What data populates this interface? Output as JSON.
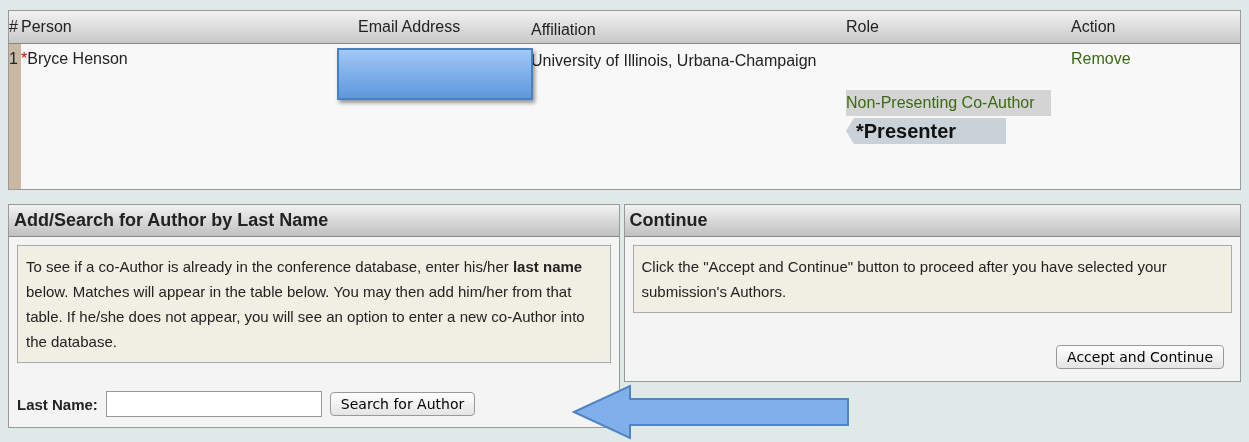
{
  "authors_table": {
    "columns": [
      "#",
      "Person",
      "Email Address",
      "Affiliation",
      "Role",
      "Action"
    ],
    "rows": [
      {
        "number": "1",
        "required_mark": "*",
        "person": "Bryce Henson",
        "affiliation": "University of Illinois, Urbana-Champaign",
        "roles": [
          {
            "label": "Non-Presenting Co-Author",
            "selected": false
          },
          {
            "label": "*Presenter",
            "selected": true
          }
        ],
        "action": "Remove"
      }
    ]
  },
  "search_panel": {
    "title": "Add/Search for Author by Last Name",
    "info": "To see if a co-Author is already in the conference database, enter his/her **last name** below. Matches will appear in the table below. You may then add him/her from that table. If he/she does not appear, you will see an option to enter a new co-Author into the database.",
    "field_label": "Last Name:",
    "button": "Search for Author"
  },
  "continue_panel": {
    "title": "Continue",
    "info": "Click the \"Accept and Continue\" button to proceed after you have selected your submission's Authors.",
    "button": "Accept and Continue"
  }
}
